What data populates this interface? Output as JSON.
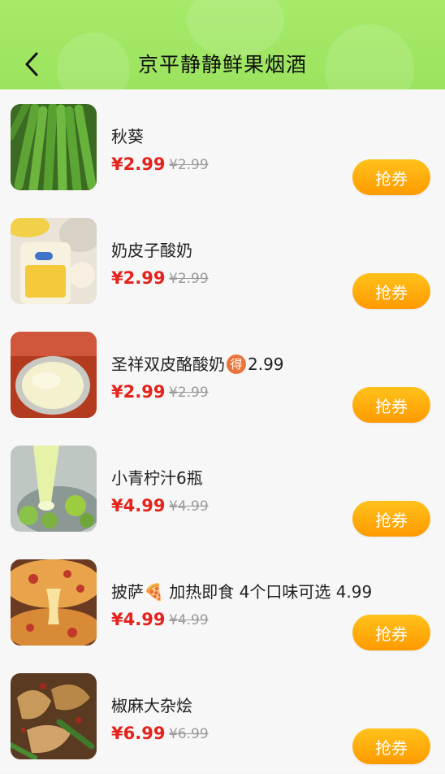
{
  "header": {
    "title": "京平静静鲜果烟酒",
    "back_icon": "chevron-left-icon"
  },
  "colors": {
    "header_bg": "#9be35e",
    "price": "#e5221b",
    "button_top": "#ffc21a",
    "button_bottom": "#ff9a00"
  },
  "products": [
    {
      "name": "秋葵",
      "price": "¥2.99",
      "original_price": "¥2.99",
      "button": "抢券",
      "image": "okra-image"
    },
    {
      "name": "奶皮子酸奶",
      "price": "¥2.99",
      "original_price": "¥2.99",
      "button": "抢券",
      "image": "yogurt-cup-image"
    },
    {
      "name_before": "圣祥双皮酪酸奶",
      "badge": "得",
      "name_after": "2.99",
      "price": "¥2.99",
      "original_price": "¥2.99",
      "button": "抢券",
      "image": "cheese-yogurt-image"
    },
    {
      "name": "小青柠汁6瓶",
      "price": "¥4.99",
      "original_price": "¥4.99",
      "button": "抢券",
      "image": "lime-juice-image"
    },
    {
      "name": "披萨🍕 加热即食 4个口味可选 4.99",
      "price": "¥4.99",
      "original_price": "¥4.99",
      "button": "抢券",
      "image": "pizza-image"
    },
    {
      "name": "椒麻大杂烩",
      "price": "¥6.99",
      "original_price": "¥6.99",
      "button": "抢券",
      "image": "spicy-mix-image"
    }
  ]
}
